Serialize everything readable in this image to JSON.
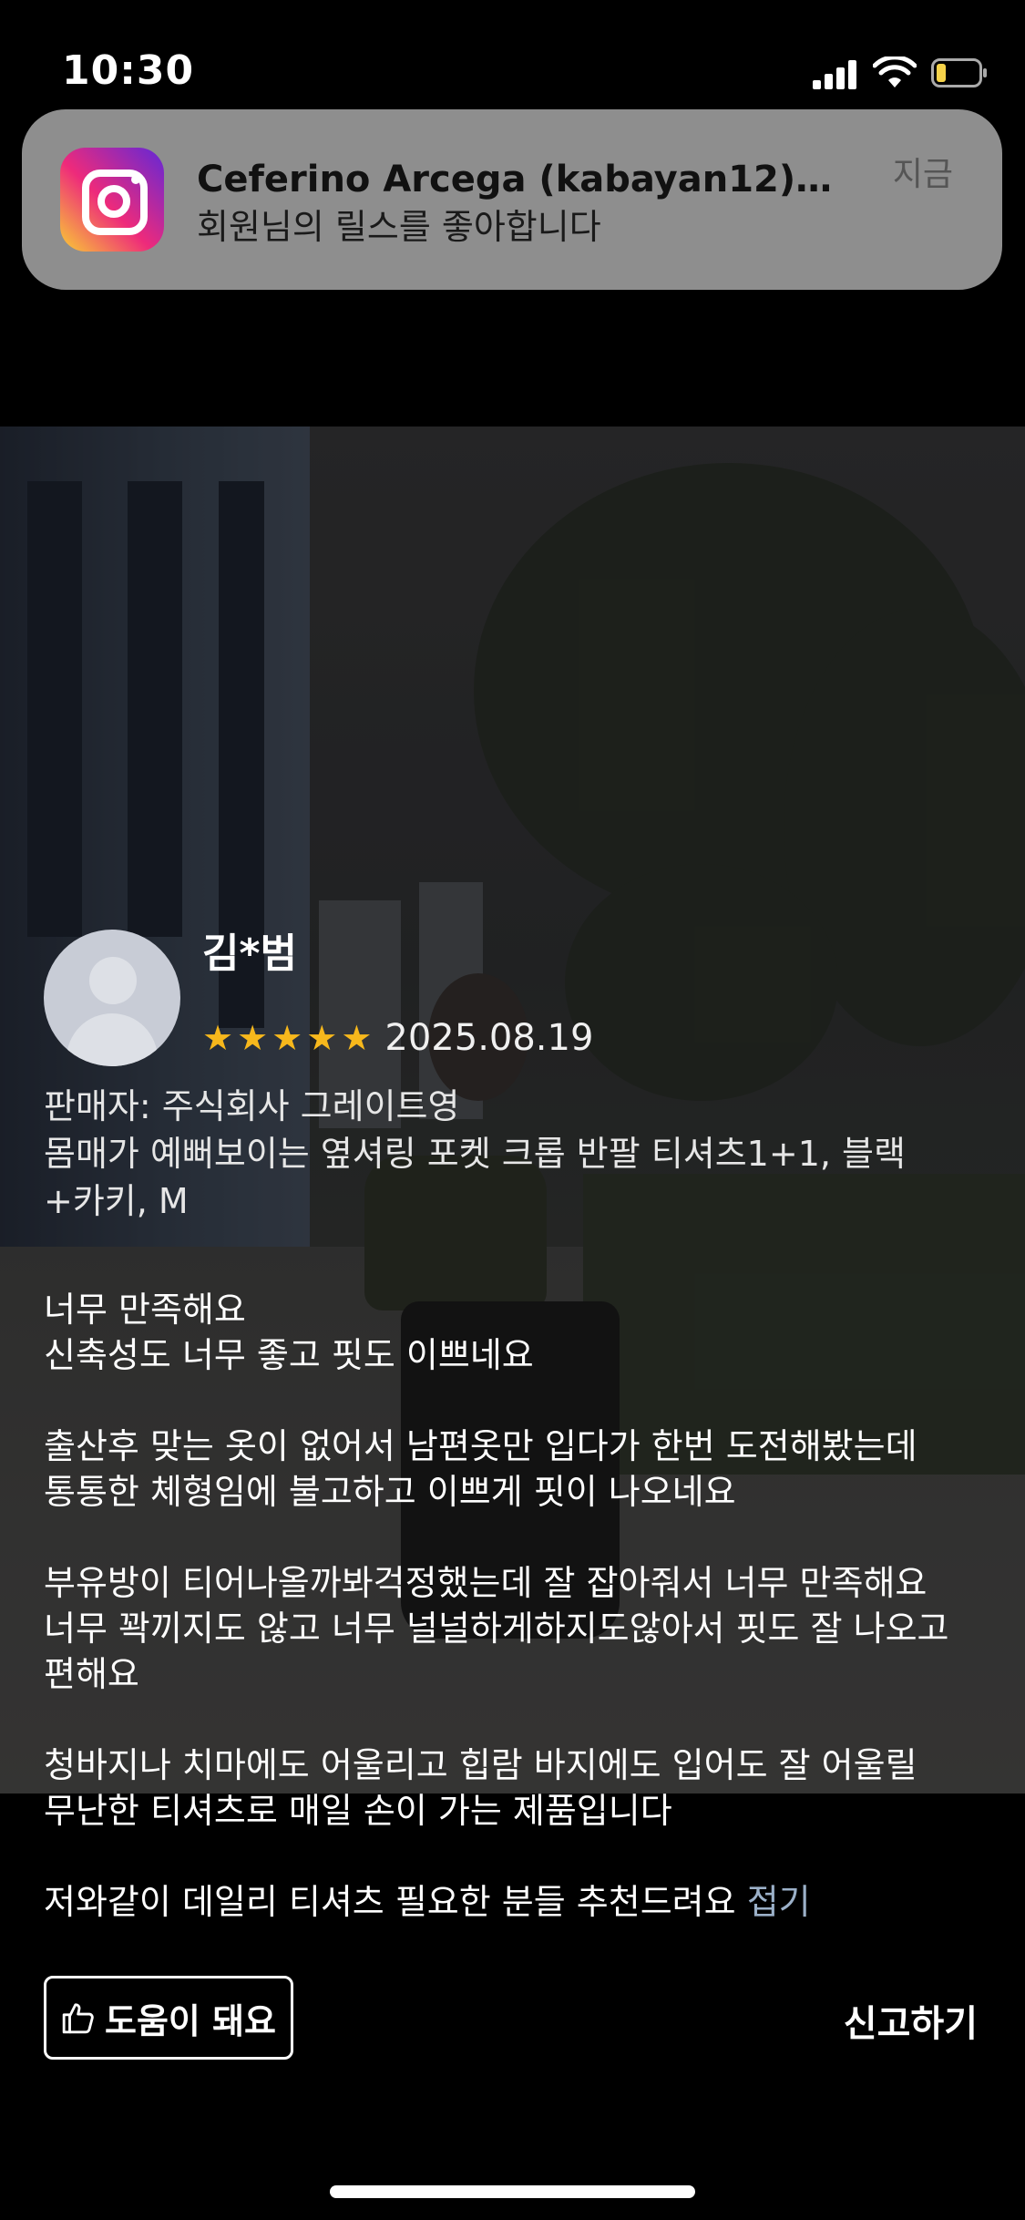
{
  "status_bar": {
    "time": "10:30",
    "icons": [
      "signal-icon",
      "wifi-icon",
      "battery-icon"
    ]
  },
  "notification": {
    "app_icon": "instagram-icon",
    "title": "Ceferino Arcega (kabayan12)님...",
    "body": "회원님의 릴스를 좋아합니다",
    "time": "지금"
  },
  "review": {
    "reviewer_name": "김*범",
    "rating": 5,
    "stars": [
      "★",
      "★",
      "★",
      "★",
      "★"
    ],
    "date": "2025.08.19",
    "seller": "판매자: 주식회사 그레이트영",
    "product": "몸매가 예뻐보이는 옆셔링 포켓 크롭 반팔 티셔츠1+1, 블랙 +카키, M",
    "paragraphs": [
      "너무 만족해요\n신축성도 너무 좋고 핏도 이쁘네요",
      "출산후 맞는 옷이 없어서 남편옷만 입다가 한번 도전해봤는데\n통통한 체형임에 불고하고 이쁘게 핏이 나오네요",
      "부유방이 티어나올까봐걱정했는데 잘 잡아줘서 너무 만족해요\n너무 꽉끼지도 않고 너무 널널하게하지도않아서 핏도 잘 나오고\n편해요",
      "청바지나 치마에도 어울리고 힙람 바지에도 입어도 잘 어울릴\n무난한 티셔츠로 매일 손이 가는 제품입니다"
    ],
    "last_paragraph": "저와같이 데일리 티셔츠 필요한 분들 추천드려요",
    "fold_label": "접기"
  },
  "actions": {
    "helpful_label": "도움이 돼요",
    "helpful_icon": "thumbs-up-icon",
    "report_label": "신고하기"
  },
  "colors": {
    "star": "#f7b81c",
    "fold_link": "#9bb0c8",
    "notification_bg": "#8e8e8e"
  }
}
